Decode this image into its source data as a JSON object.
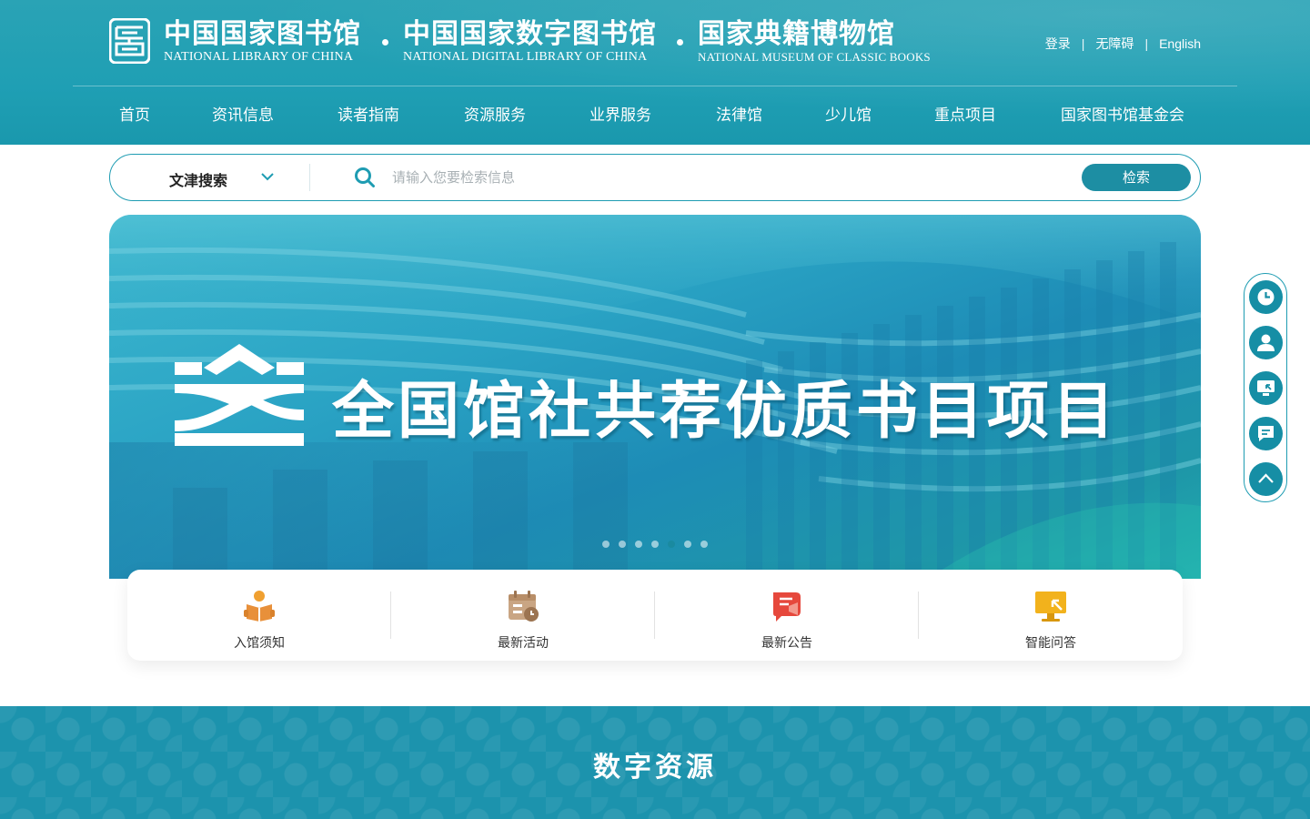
{
  "header": {
    "libraries": [
      {
        "cn": "中国国家图书馆",
        "en": "NATIONAL LIBRARY OF CHINA"
      },
      {
        "cn": "中国国家数字图书馆",
        "en": "NATIONAL DIGITAL LIBRARY OF CHINA"
      },
      {
        "cn": "国家典籍博物馆",
        "en": "NATIONAL MUSEUM OF CLASSIC BOOKS"
      }
    ],
    "top_links": {
      "login": "登录",
      "accessibility": "无障碍",
      "english": "English",
      "separator": "|"
    }
  },
  "nav": {
    "items": [
      "首页",
      "资讯信息",
      "读者指南",
      "资源服务",
      "业界服务",
      "法律馆",
      "少儿馆",
      "重点项目",
      "国家图书馆基金会"
    ]
  },
  "search": {
    "type_label": "文津搜索",
    "placeholder": "请输入您要检索信息",
    "button_label": "检索"
  },
  "banner": {
    "title": "全国馆社共荐优质书目项目",
    "slide_count": 7,
    "active_slide": 5
  },
  "quick_links": {
    "items": [
      {
        "label": "入馆须知",
        "icon": "reading-person-icon"
      },
      {
        "label": "最新活动",
        "icon": "calendar-clock-icon"
      },
      {
        "label": "最新公告",
        "icon": "announcement-flag-icon"
      },
      {
        "label": "智能问答",
        "icon": "smart-screen-icon"
      }
    ]
  },
  "sections": {
    "digital_resources_title": "数字资源"
  },
  "side_toolbar": {
    "items": [
      "clock-icon",
      "user-icon",
      "screen-icon",
      "chat-icon",
      "back-to-top-icon"
    ]
  },
  "colors": {
    "primary": "#1e9cb2",
    "button": "#1d8ea3",
    "icon_orange": "#f0a030",
    "icon_red": "#e6483c"
  }
}
